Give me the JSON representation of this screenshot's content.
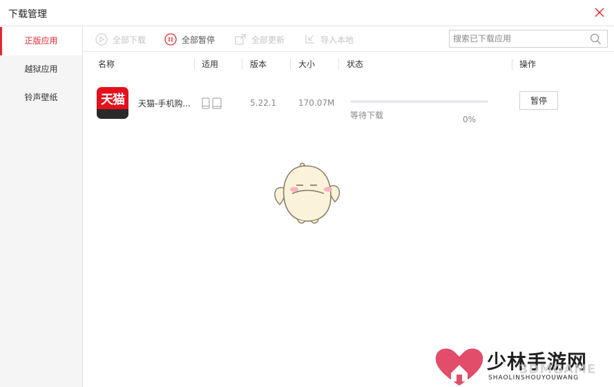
{
  "window": {
    "title": "下载管理"
  },
  "sidebar": {
    "items": [
      {
        "label": "正版应用",
        "active": true
      },
      {
        "label": "越狱应用",
        "active": false
      },
      {
        "label": "铃声壁纸",
        "active": false
      }
    ]
  },
  "toolbar": {
    "download_all": "全部下载",
    "pause_all": "全部暂停",
    "update_all": "全部更新",
    "import_local": "导入本地",
    "search_placeholder": "搜索已下载应用"
  },
  "table": {
    "columns": [
      "名称",
      "适用",
      "版本",
      "大小",
      "状态",
      "操作"
    ],
    "rows": [
      {
        "icon_text": "天猫",
        "name": "天猫-手机购...",
        "version": "5.22.1",
        "size": "170.07M",
        "status": "等待下载",
        "progress": 0,
        "progress_label": "0%",
        "action": "暂停"
      }
    ]
  },
  "watermark": {
    "title": "少林手游网",
    "subtitle": "SHAOLINSHOUYOUWANG",
    "overlay": "3DMGAME"
  },
  "colors": {
    "accent": "#e5282f",
    "app_icon_bg": "#e5101c"
  }
}
